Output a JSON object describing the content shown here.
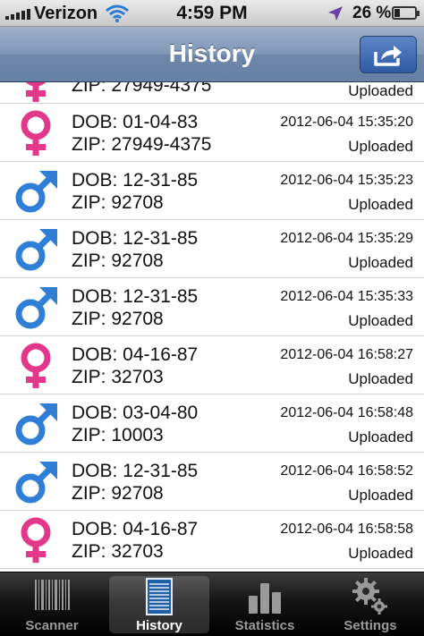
{
  "status": {
    "carrier": "Verizon",
    "time": "4:59 PM",
    "battery": "26 %",
    "battery_level": 0.26
  },
  "nav": {
    "title": "History"
  },
  "history": {
    "partial_row": {
      "gender": "female",
      "zip": "ZIP: 27949-4375",
      "status": "Uploaded"
    },
    "rows": [
      {
        "gender": "female",
        "dob": "DOB: 01-04-83",
        "zip": "ZIP: 27949-4375",
        "timestamp": "2012-06-04 15:35:20",
        "status": "Uploaded"
      },
      {
        "gender": "male",
        "dob": "DOB: 12-31-85",
        "zip": "ZIP: 92708",
        "timestamp": "2012-06-04 15:35:23",
        "status": "Uploaded"
      },
      {
        "gender": "male",
        "dob": "DOB: 12-31-85",
        "zip": "ZIP: 92708",
        "timestamp": "2012-06-04 15:35:29",
        "status": "Uploaded"
      },
      {
        "gender": "male",
        "dob": "DOB: 12-31-85",
        "zip": "ZIP: 92708",
        "timestamp": "2012-06-04 15:35:33",
        "status": "Uploaded"
      },
      {
        "gender": "female",
        "dob": "DOB: 04-16-87",
        "zip": "ZIP: 32703",
        "timestamp": "2012-06-04 16:58:27",
        "status": "Uploaded"
      },
      {
        "gender": "male",
        "dob": "DOB: 03-04-80",
        "zip": "ZIP: 10003",
        "timestamp": "2012-06-04 16:58:48",
        "status": "Uploaded"
      },
      {
        "gender": "male",
        "dob": "DOB: 12-31-85",
        "zip": "ZIP: 92708",
        "timestamp": "2012-06-04 16:58:52",
        "status": "Uploaded"
      },
      {
        "gender": "female",
        "dob": "DOB: 04-16-87",
        "zip": "ZIP: 32703",
        "timestamp": "2012-06-04 16:58:58",
        "status": "Uploaded"
      }
    ]
  },
  "tabs": [
    {
      "label": "Scanner",
      "icon": "barcode-icon"
    },
    {
      "label": "History",
      "icon": "list-icon",
      "active": true
    },
    {
      "label": "Statistics",
      "icon": "bar-chart-icon"
    },
    {
      "label": "Settings",
      "icon": "gears-icon"
    }
  ],
  "colors": {
    "female": "#e2378b",
    "male": "#2f7fd6",
    "nav": "#7f97b8"
  }
}
